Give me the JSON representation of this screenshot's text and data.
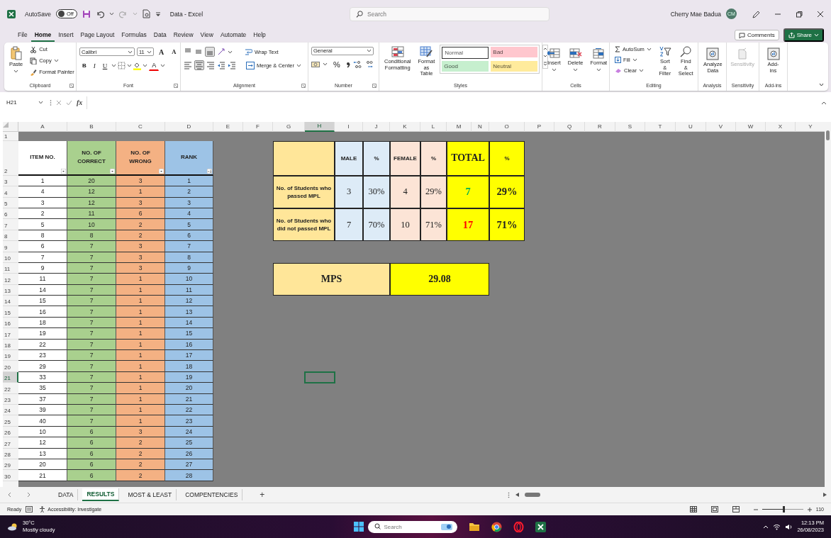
{
  "title_bar": {
    "autosave_label": "AutoSave",
    "autosave_state": "Off",
    "autosave_on": false,
    "document_title": "Data  -  Excel",
    "search_placeholder": "Search",
    "user_name": "Cherry Mae Badua",
    "user_initials": "CM"
  },
  "menu_tabs": [
    {
      "label": "File",
      "selected": false
    },
    {
      "label": "Home",
      "selected": true
    },
    {
      "label": "Insert",
      "selected": false
    },
    {
      "label": "Page Layout",
      "selected": false
    },
    {
      "label": "Formulas",
      "selected": false
    },
    {
      "label": "Data",
      "selected": false
    },
    {
      "label": "Review",
      "selected": false
    },
    {
      "label": "View",
      "selected": false
    },
    {
      "label": "Automate",
      "selected": false
    },
    {
      "label": "Help",
      "selected": false
    }
  ],
  "comments_button": "Comments",
  "share_button": "Share",
  "ribbon": [
    {
      "kind": "clipboard",
      "label": "Clipboard",
      "paste": "Paste",
      "cut": "Cut",
      "copy": "Copy",
      "format_painter": "Format Painter"
    },
    {
      "kind": "font",
      "label": "Font",
      "font_name": "Calibri",
      "font_size": "11",
      "grow": "A",
      "shrink": "A",
      "bold": "B",
      "italic": "I",
      "underline": "U",
      "font_color": "A"
    },
    {
      "kind": "alignment",
      "label": "Alignment",
      "vertical": [
        {
          "selected": false
        },
        {
          "selected": false
        },
        {
          "selected": true
        }
      ],
      "horizontal": [
        {
          "selected": false
        },
        {
          "selected": true
        },
        {
          "selected": false
        }
      ],
      "wrap_text": "Wrap Text",
      "merge": "Merge & Center"
    },
    {
      "kind": "number",
      "label": "Number",
      "format": "General",
      "percent": "%"
    },
    {
      "kind": "styles",
      "label": "Styles",
      "conditional": "Conditional Formatting",
      "format_table": "Format as Table",
      "styles": [
        {
          "label": "Normal",
          "color": "#ffffff"
        },
        {
          "label": "Bad",
          "color": "#ffc7ce"
        },
        {
          "label": "Good",
          "color": "#c6efce"
        },
        {
          "label": "Neutral",
          "color": "#ffeb9c"
        }
      ]
    },
    {
      "kind": "cells",
      "label": "Cells",
      "buttons": [
        "Insert",
        "Delete",
        "Format"
      ]
    },
    {
      "kind": "editing",
      "label": "Editing",
      "autosum": "AutoSum",
      "fill": "Fill",
      "clear": "Clear",
      "sort": "Sort & Filter",
      "find": "Find & Select"
    },
    {
      "kind": "single",
      "label": "Analysis",
      "button": "Analyze Data",
      "disabled": false
    },
    {
      "kind": "single",
      "label": "Sensitivity",
      "button": "Sensitivity",
      "disabled": true
    },
    {
      "kind": "single",
      "label": "Add-ins",
      "button": "Add-ins",
      "disabled": false
    }
  ],
  "formula_bar": {
    "name_box": "H21",
    "function_label": "fx"
  },
  "sheet": {
    "column_headers": [
      {
        "label": "A",
        "selected": false
      },
      {
        "label": "B",
        "selected": false
      },
      {
        "label": "C",
        "selected": false
      },
      {
        "label": "D",
        "selected": false
      },
      {
        "label": "E",
        "selected": false
      },
      {
        "label": "F",
        "selected": false
      },
      {
        "label": "G",
        "selected": false
      },
      {
        "label": "H",
        "selected": true
      },
      {
        "label": "I",
        "selected": false
      },
      {
        "label": "J",
        "selected": false
      },
      {
        "label": "K",
        "selected": false
      },
      {
        "label": "L",
        "selected": false
      },
      {
        "label": "M",
        "selected": false
      },
      {
        "label": "N",
        "selected": false
      },
      {
        "label": "O",
        "selected": false
      },
      {
        "label": "P",
        "selected": false
      },
      {
        "label": "Q",
        "selected": false
      },
      {
        "label": "R",
        "selected": false
      },
      {
        "label": "S",
        "selected": false
      },
      {
        "label": "T",
        "selected": false
      },
      {
        "label": "U",
        "selected": false
      },
      {
        "label": "V",
        "selected": false
      },
      {
        "label": "W",
        "selected": false
      },
      {
        "label": "X",
        "selected": false
      },
      {
        "label": "Y",
        "selected": false
      }
    ],
    "row_headers": [
      {
        "label": "1",
        "selected": false
      },
      {
        "label": "2",
        "selected": false
      },
      {
        "label": "3",
        "selected": false
      },
      {
        "label": "4",
        "selected": false
      },
      {
        "label": "5",
        "selected": false
      },
      {
        "label": "6",
        "selected": false
      },
      {
        "label": "7",
        "selected": false
      },
      {
        "label": "8",
        "selected": false
      },
      {
        "label": "9",
        "selected": false
      },
      {
        "label": "10",
        "selected": false
      },
      {
        "label": "11",
        "selected": false
      },
      {
        "label": "12",
        "selected": false
      },
      {
        "label": "13",
        "selected": false
      },
      {
        "label": "14",
        "selected": false
      },
      {
        "label": "15",
        "selected": false
      },
      {
        "label": "16",
        "selected": false
      },
      {
        "label": "17",
        "selected": false
      },
      {
        "label": "18",
        "selected": false
      },
      {
        "label": "19",
        "selected": false
      },
      {
        "label": "20",
        "selected": false
      },
      {
        "label": "21",
        "selected": true
      },
      {
        "label": "22",
        "selected": false
      },
      {
        "label": "23",
        "selected": false
      },
      {
        "label": "24",
        "selected": false
      },
      {
        "label": "25",
        "selected": false
      },
      {
        "label": "26",
        "selected": false
      },
      {
        "label": "27",
        "selected": false
      },
      {
        "label": "28",
        "selected": false
      },
      {
        "label": "29",
        "selected": false
      },
      {
        "label": "30",
        "selected": false
      }
    ],
    "item_table": {
      "columns": [
        {
          "label": "ITEM NO.",
          "kind": "filter",
          "color": "#ffffff"
        },
        {
          "label": "NO. OF CORRECT",
          "kind": "filter",
          "color": "#a9d08e"
        },
        {
          "label": "NO. OF WRONG",
          "kind": "filter",
          "color": "#f4b183"
        },
        {
          "label": "RANK",
          "kind": "sorted",
          "color": "#9dc3e6"
        }
      ],
      "rows": [
        [
          "1",
          "20",
          "3",
          "1"
        ],
        [
          "4",
          "12",
          "1",
          "2"
        ],
        [
          "3",
          "12",
          "3",
          "3"
        ],
        [
          "2",
          "11",
          "6",
          "4"
        ],
        [
          "5",
          "10",
          "2",
          "5"
        ],
        [
          "8",
          "8",
          "2",
          "6"
        ],
        [
          "6",
          "7",
          "3",
          "7"
        ],
        [
          "7",
          "7",
          "3",
          "8"
        ],
        [
          "9",
          "7",
          "3",
          "9"
        ],
        [
          "11",
          "7",
          "1",
          "10"
        ],
        [
          "14",
          "7",
          "1",
          "11"
        ],
        [
          "15",
          "7",
          "1",
          "12"
        ],
        [
          "16",
          "7",
          "1",
          "13"
        ],
        [
          "18",
          "7",
          "1",
          "14"
        ],
        [
          "19",
          "7",
          "1",
          "15"
        ],
        [
          "22",
          "7",
          "1",
          "16"
        ],
        [
          "23",
          "7",
          "1",
          "17"
        ],
        [
          "29",
          "7",
          "1",
          "18"
        ],
        [
          "33",
          "7",
          "1",
          "19"
        ],
        [
          "35",
          "7",
          "1",
          "20"
        ],
        [
          "37",
          "7",
          "1",
          "21"
        ],
        [
          "39",
          "7",
          "1",
          "22"
        ],
        [
          "40",
          "7",
          "1",
          "23"
        ],
        [
          "10",
          "6",
          "3",
          "24"
        ],
        [
          "12",
          "6",
          "2",
          "25"
        ],
        [
          "13",
          "6",
          "2",
          "26"
        ],
        [
          "20",
          "6",
          "2",
          "27"
        ],
        [
          "21",
          "6",
          "2",
          "28"
        ]
      ]
    },
    "summary_table": {
      "columns": [
        {
          "label": "MALE",
          "kind": "plain",
          "color": "#ddebf7"
        },
        {
          "label": "%",
          "kind": "plain",
          "color": "#ddebf7"
        },
        {
          "label": "FEMALE",
          "kind": "plain",
          "color": "#fce4d6"
        },
        {
          "label": "%",
          "kind": "plain",
          "color": "#fce4d6"
        },
        {
          "label": "TOTAL",
          "kind": "total",
          "color": "#ffff00"
        },
        {
          "label": "%",
          "kind": "total_percent",
          "color": "#ffff00"
        }
      ],
      "rows": [
        {
          "label": "No. of Students who passed MPL",
          "values": [
            "3",
            "30%",
            "4",
            "29%",
            "7",
            "29%"
          ],
          "color": "#00b050"
        },
        {
          "label": "No. of Students who did not passed MPL",
          "values": [
            "7",
            "70%",
            "10",
            "71%",
            "17",
            "71%"
          ],
          "color": "#ff0000"
        }
      ]
    },
    "mps": {
      "label": "MPS",
      "value": "29.08"
    }
  },
  "sheet_tabs": [
    {
      "label": "DATA",
      "selected": false
    },
    {
      "label": "RESULTS",
      "selected": true
    },
    {
      "label": "MOST & LEAST",
      "selected": false
    },
    {
      "label": "COMPENTENCIES",
      "selected": false
    }
  ],
  "add_sheet": "+",
  "status_bar": {
    "mode": "Ready",
    "accessibility": "Accessibility: Investigate",
    "zoom": {
      "level": 0.55,
      "label": "110"
    }
  },
  "taskbar": {
    "weather_temp": "30°C",
    "weather_text": "Mostly cloudy",
    "search_placeholder": "Search",
    "time": "12:13 PM",
    "date": "26/08/2023"
  }
}
